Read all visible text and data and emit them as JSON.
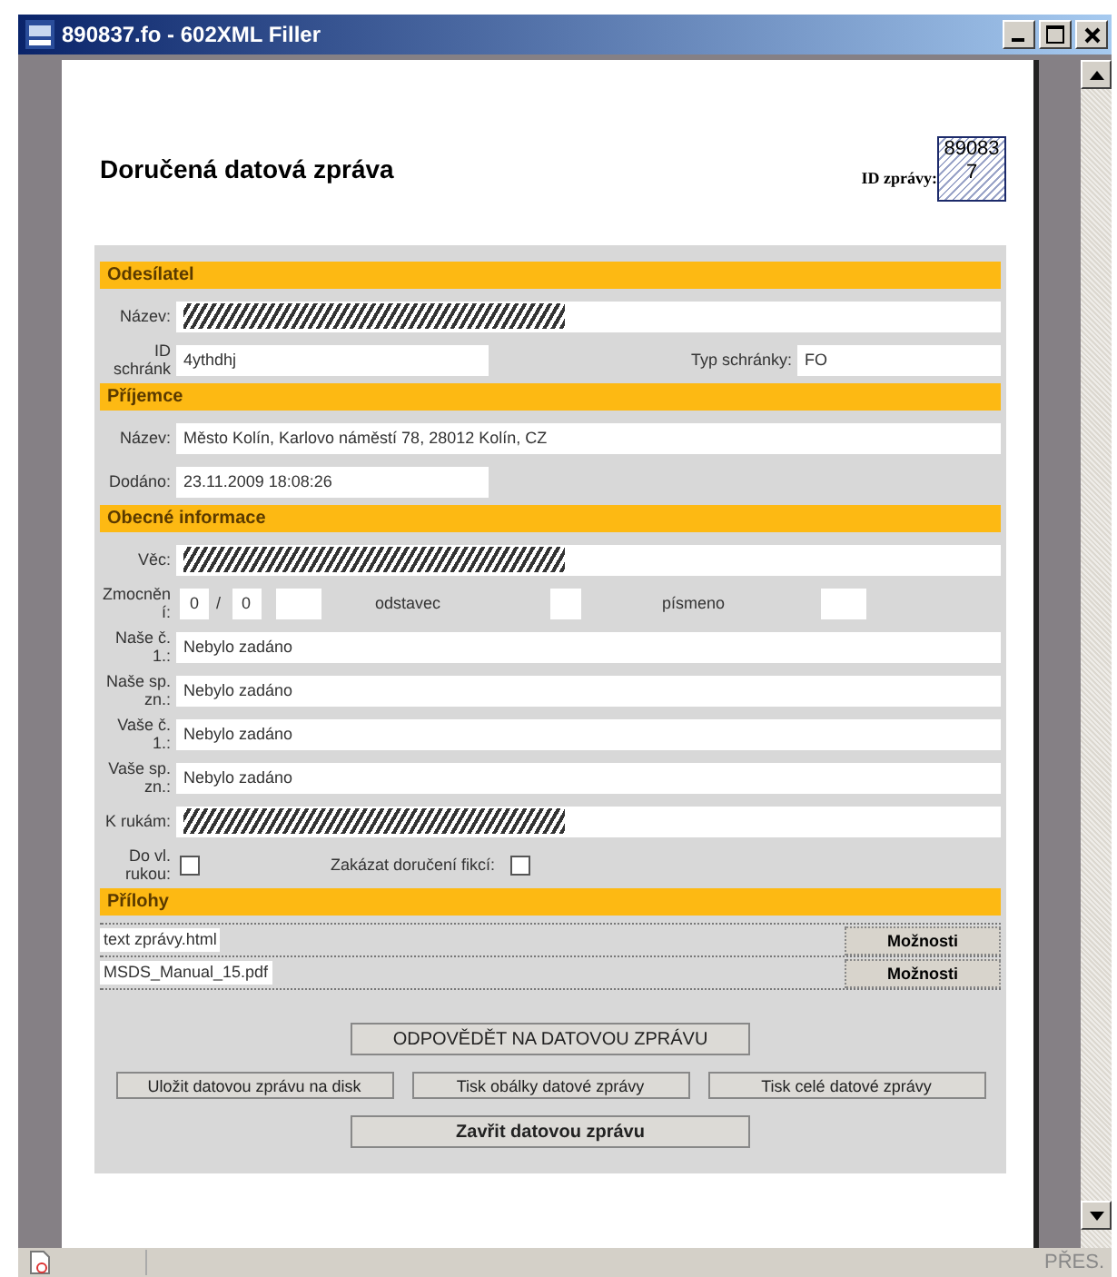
{
  "window": {
    "title": "890837.fo - 602XML Filler"
  },
  "document": {
    "title": "Doručená datová zpráva",
    "id_label": "ID zprávy:",
    "id_value": "890837"
  },
  "sections": [
    {
      "title": "Odesílatel",
      "rows": [
        {
          "kind": "field",
          "label": "Název:",
          "redacted": true
        },
        {
          "kind": "pair",
          "label": "ID schránk",
          "value": "4ythdhj",
          "label2": "Typ schránky:",
          "value2": "FO"
        }
      ]
    },
    {
      "title": "Příjemce",
      "rows": [
        {
          "kind": "field",
          "label": "Název:",
          "value": "Město Kolín, Karlovo náměstí 78, 28012 Kolín, CZ"
        },
        {
          "kind": "short",
          "label": "Dodáno:",
          "value": "23.11.2009 18:08:26"
        }
      ]
    },
    {
      "title": "Obecné informace",
      "rows": [
        {
          "kind": "field",
          "label": "Věc:",
          "redacted": true
        },
        {
          "kind": "authority",
          "label": "Zmocnění:",
          "value": "0",
          "sep": "/",
          "value2": "0",
          "label2": "odstavec",
          "label3": "písmeno"
        },
        {
          "kind": "field",
          "label": "Naše č. 1.:",
          "value": "Nebylo zadáno"
        },
        {
          "kind": "field",
          "label": "Naše sp. zn.:",
          "value": "Nebylo zadáno"
        },
        {
          "kind": "field",
          "label": "Vaše č. 1.:",
          "value": "Nebylo zadáno"
        },
        {
          "kind": "field",
          "label": "Vaše sp. zn.:",
          "value": "Nebylo zadáno"
        },
        {
          "kind": "field",
          "label": "K rukám:",
          "redacted": true
        },
        {
          "kind": "checks",
          "label": "Do vl. rukou:",
          "checked": false,
          "label2": "Zakázat doručení fikcí:",
          "checked2": false
        }
      ]
    }
  ],
  "attachments": {
    "title": "Přílohy",
    "items": [
      {
        "name": "text zprávy.html",
        "button": "Možnosti"
      },
      {
        "name": "MSDS_Manual_15.pdf",
        "button": "Možnosti"
      }
    ]
  },
  "buttons": {
    "reply": "ODPOVĚDĚT NA DATOVOU ZPRÁVU",
    "row": [
      "Uložit datovou zprávu na disk",
      "Tisk obálky datové zprávy",
      "Tisk celé datové zprávy"
    ],
    "close": "Zavřit datovou zprávu"
  },
  "status_bar": {
    "mode": "PŘES."
  }
}
